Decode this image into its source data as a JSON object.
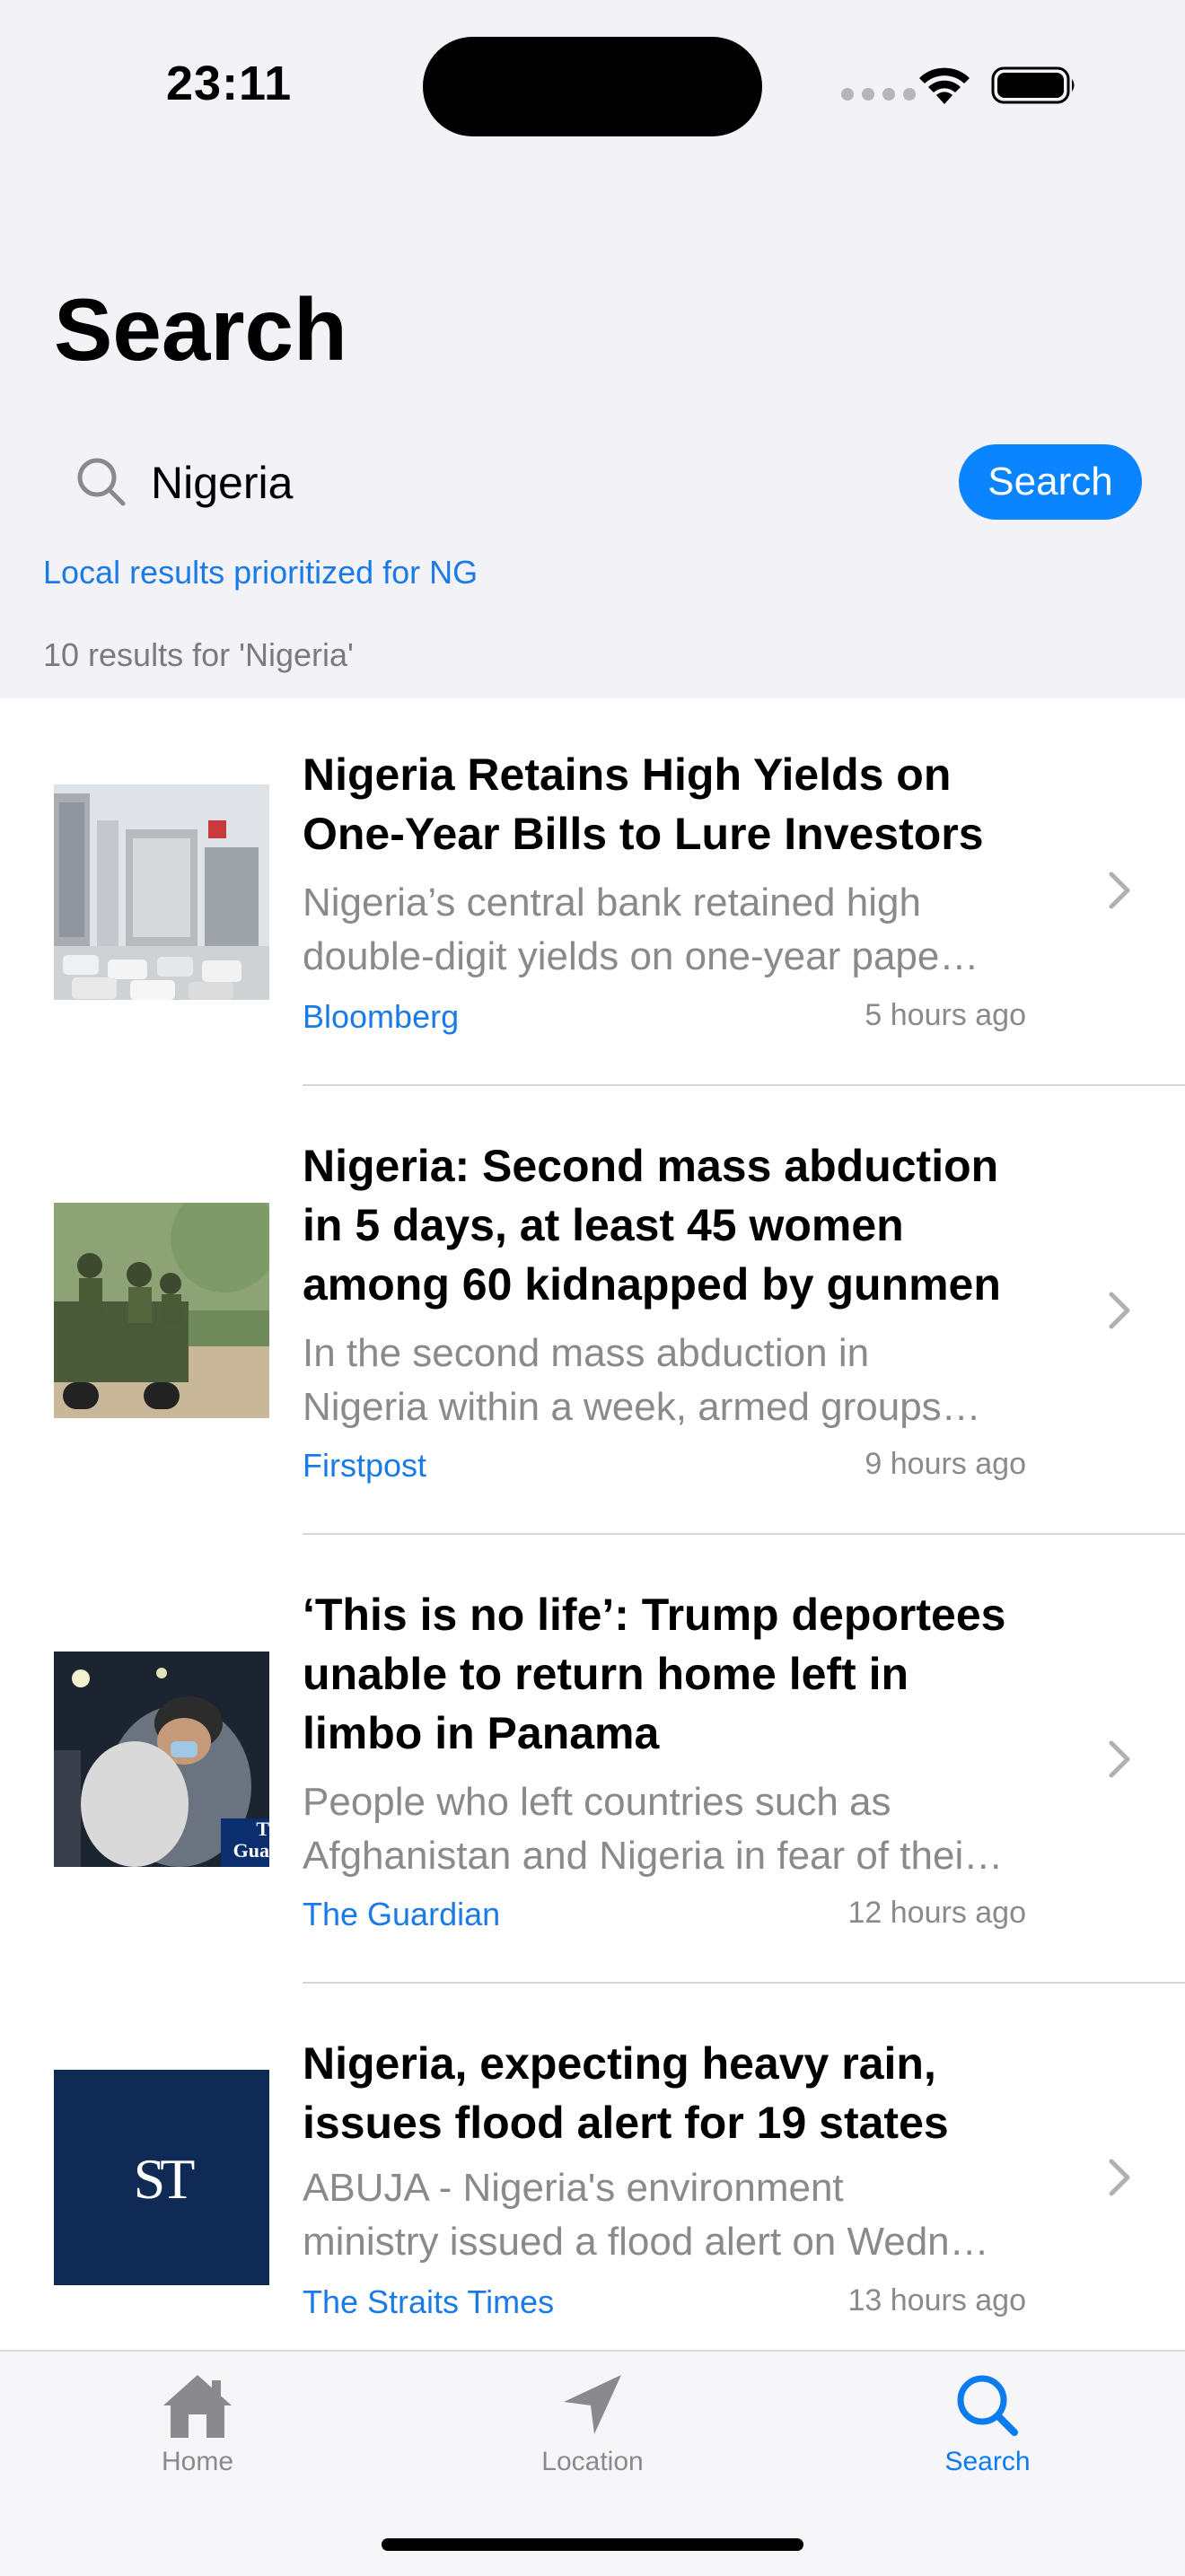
{
  "status_bar": {
    "time": "23:11"
  },
  "header": {
    "title": "Search"
  },
  "search": {
    "query": "Nigeria",
    "placeholder": "Search",
    "button_label": "Search",
    "local_note": "Local results prioritized for NG",
    "result_count": "10 results for 'Nigeria'"
  },
  "results": [
    {
      "headline": "Nigeria Retains High Yields on One-Year Bills to Lure Investors",
      "summary_line1": "Nigeria’s central bank retained high",
      "summary_line2": "double-digit yields on one-year pape…",
      "source": "Bloomberg",
      "age": "5 hours ago",
      "thumbnail": "city-buildings-traffic-photo"
    },
    {
      "headline": "Nigeria: Second mass abduction in 5 days, at least 45 women among 60 kidnapped by gunmen",
      "summary_line1": "In the second mass abduction in",
      "summary_line2": "Nigeria within a week, armed groups…",
      "source": "Firstpost",
      "age": "9 hours ago",
      "thumbnail": "soldiers-truck-photo"
    },
    {
      "headline": "‘This is no life’: Trump deportees unable to return home left in limbo in Panama",
      "summary_line1": "People who left countries such as",
      "summary_line2": "Afghanistan and Nigeria in fear of thei…",
      "source": "The Guardian",
      "age": "12 hours ago",
      "thumbnail": "embrace-night-photo",
      "thumbnail_badge": "T\nGua"
    },
    {
      "headline": "Nigeria, expecting heavy rain, issues flood alert for 19 states",
      "summary_line1": "ABUJA - Nigeria's environment",
      "summary_line2": "ministry issued a flood alert on Wedn…",
      "source": "The Straits Times",
      "age": "13 hours ago",
      "thumbnail": "straits-times-logo",
      "thumbnail_logo_text": "ST"
    }
  ],
  "tab_bar": {
    "tabs": [
      {
        "label": "Home",
        "icon": "house-icon",
        "active": false
      },
      {
        "label": "Location",
        "icon": "location-arrow-icon",
        "active": false
      },
      {
        "label": "Search",
        "icon": "magnifier-icon",
        "active": true
      }
    ]
  },
  "colors": {
    "accent": "#0a84ff",
    "link": "#1a7be6",
    "secondary_text": "#8a8a8e",
    "header_background": "#f2f2f7",
    "straits_times_navy": "#0f2a55"
  }
}
